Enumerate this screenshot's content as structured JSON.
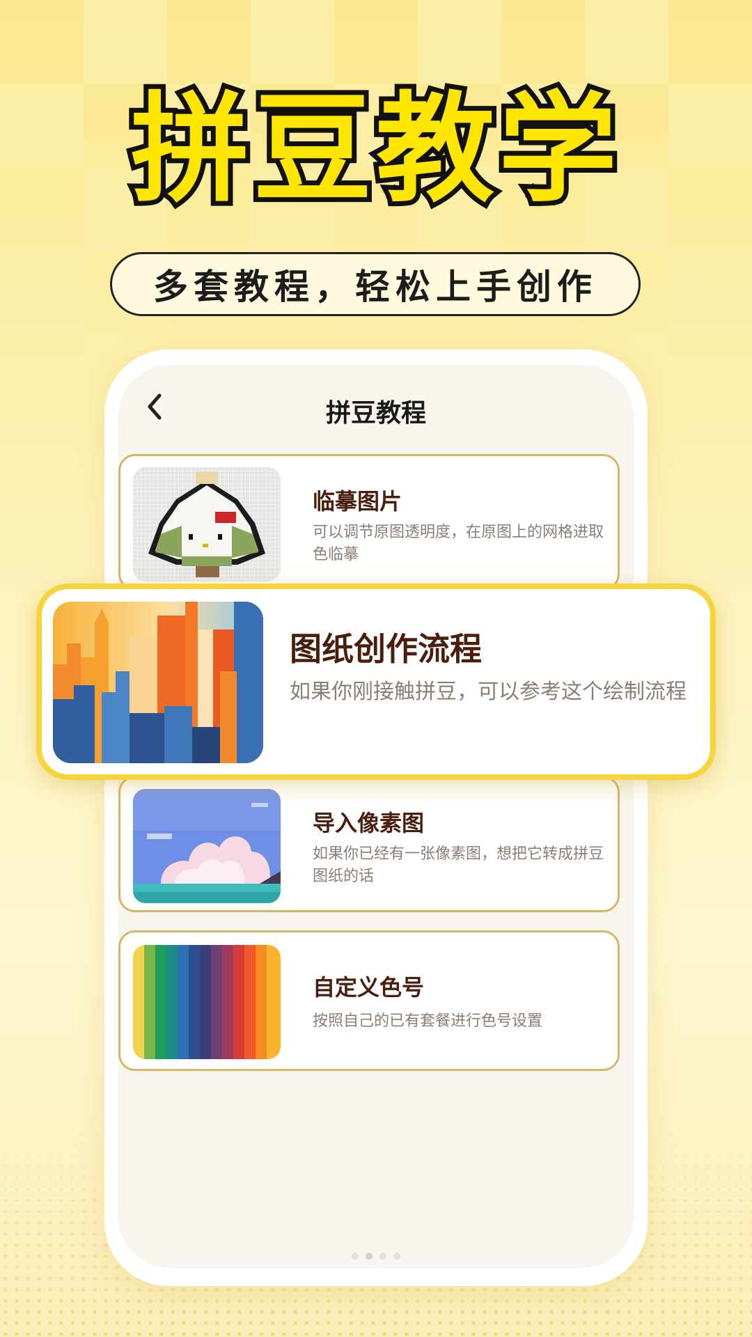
{
  "hero": {
    "title": "拼豆教学",
    "subtitle": "多套教程，轻松上手创作"
  },
  "screen": {
    "nav_title": "拼豆教程",
    "back_icon": "chevron-left-icon"
  },
  "tutorials": [
    {
      "title": "临摹图片",
      "description": "可以调节原图透明度，在原图上的网格进取色临摹",
      "thumb": "pixel-bead-character-image"
    },
    {
      "title": "图纸创作流程",
      "description": "如果你刚接触拼豆，可以参考这个绘制流程",
      "thumb": "city-skyline-image"
    },
    {
      "title": "导入像素图",
      "description": "如果你已经有一张像素图，想把它转成拼豆图纸的话",
      "thumb": "pixel-clouds-sea-image"
    },
    {
      "title": "自定义色号",
      "description": "按照自己的已有套餐进行色号设置",
      "thumb": "color-stripes-image"
    }
  ],
  "colors": {
    "accent_yellow": "#f8d43c",
    "card_border": "#d8b669",
    "title_brown": "#4a1e0d",
    "desc_gray": "#8c7d73"
  }
}
